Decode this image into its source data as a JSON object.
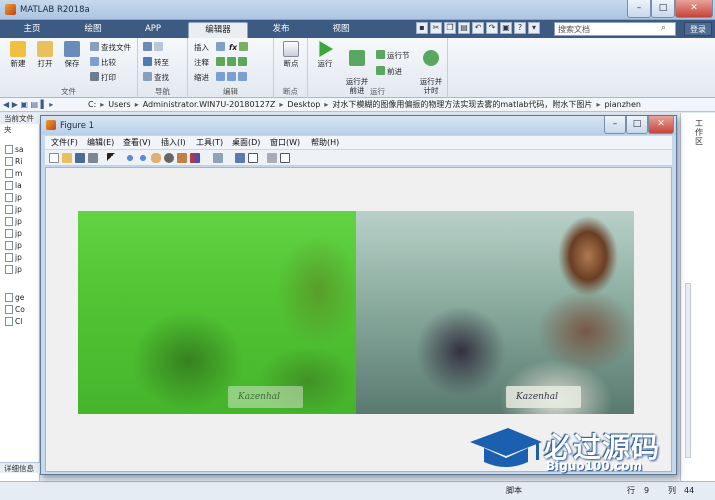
{
  "app": {
    "title": "MATLAB R2018a"
  },
  "tabs": [
    {
      "label": "主页"
    },
    {
      "label": "绘图"
    },
    {
      "label": "APP"
    },
    {
      "label": "编辑器",
      "active": true
    },
    {
      "label": "发布"
    },
    {
      "label": "视图"
    }
  ],
  "search": {
    "placeholder": "搜索文档",
    "login": "登录"
  },
  "toolstrip": {
    "file": {
      "label": "文件",
      "new": "新建",
      "open": "打开",
      "save": "保存",
      "find_files": "查找文件",
      "compare": "比较",
      "print": "打印"
    },
    "navigate": {
      "label": "导航",
      "goto": "转至",
      "find": "查找"
    },
    "edit": {
      "label": "编辑",
      "insert": "插入",
      "comment": "注释",
      "indent": "缩进",
      "fx": "fx"
    },
    "breakpoints": {
      "label": "断点",
      "breakpoints": "断点"
    },
    "run": {
      "label": "运行",
      "run": "运行",
      "run_advance": "运行并\n前进",
      "run_section": "运行节",
      "advance": "前进",
      "run_time": "运行并\n计时"
    }
  },
  "address": {
    "segments": [
      "C:",
      "Users",
      "Administrator.WIN7U-20180127Z",
      "Desktop",
      "对水下模糊的图像用偏振的物理方法实现去雾的matlab代码，附水下图片",
      "pianzhen"
    ]
  },
  "left_panel": {
    "header": "当前文件夹",
    "files": [
      "sa",
      "Ri",
      "m",
      "la",
      "jp",
      "jp",
      "jp",
      "jp",
      "jp",
      "jp",
      "jp",
      "ge",
      "Co",
      "Cl"
    ],
    "details": "详细信息"
  },
  "right_panel": {
    "title": "工作区"
  },
  "status": {
    "mode": "脚本",
    "row_label": "行",
    "row": "9",
    "col_label": "列",
    "col": "44"
  },
  "figure": {
    "title": "Figure 1",
    "menu": [
      "文件(F)",
      "编辑(E)",
      "查看(V)",
      "插入(I)",
      "工具(T)",
      "桌面(D)",
      "窗口(W)",
      "帮助(H)"
    ],
    "plaque_text": "Kazenhal"
  },
  "watermark": {
    "main": "必过源码",
    "sub": "Biguo100.com"
  },
  "colors": {
    "tab_bar": "#3c5a82",
    "watermark_blue": "#1a4f8f"
  }
}
